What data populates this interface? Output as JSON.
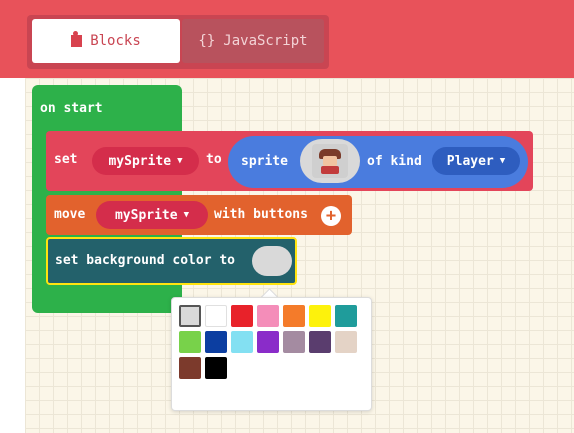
{
  "header": {
    "tabs": [
      {
        "label": "Blocks",
        "icon": "puzzle-icon",
        "active": true
      },
      {
        "label": "JavaScript",
        "icon": "braces-icon",
        "active": false
      }
    ],
    "js_glyph": "{}"
  },
  "blocks": {
    "on_start": {
      "label": "on start",
      "color": "#2db14a"
    },
    "set_sprite": {
      "set_label": "set",
      "variable": "mySprite",
      "to_label": "to",
      "sprite_label": "sprite",
      "of_kind_label": "of kind",
      "kind": "Player",
      "color": "#e3455a"
    },
    "move_sprite": {
      "move_label": "move",
      "variable": "mySprite",
      "with_buttons_label": "with buttons",
      "color": "#e2622d"
    },
    "set_background": {
      "label": "set background color to",
      "color": "#23616b"
    }
  },
  "dropdown_arrow": "▼",
  "color_palette": {
    "selected_index": 0,
    "colors": [
      "#d9d9d9",
      "#ffffff",
      "#e8222a",
      "#f48db9",
      "#f47b2a",
      "#fdf20c",
      "#1f9c9b",
      "#78d24a",
      "#0c3ea1",
      "#83e0f2",
      "#8a2cc9",
      "#a48ba1",
      "#5a3d6e",
      "#e4d3c6",
      "#7c3a2c",
      "#000000"
    ]
  }
}
